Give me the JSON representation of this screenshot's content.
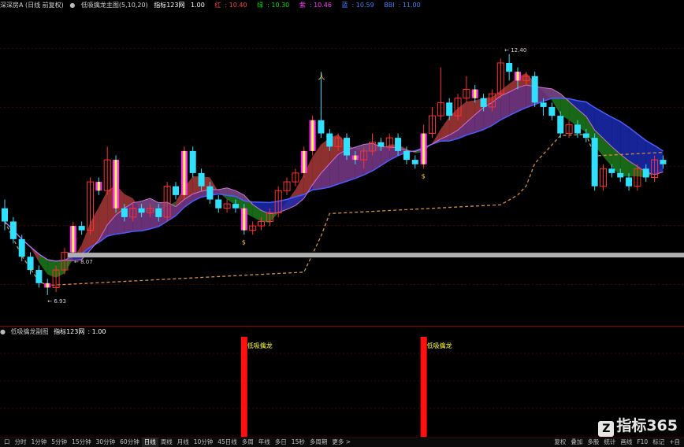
{
  "header": {
    "stock_title": "深深房A (日线 前复权)",
    "indicator_name": "低吸擒龙主图(5,10,20)",
    "label_indicator": "指标123网",
    "label_indicator_value": "1.00",
    "label_red": "红",
    "label_red_value": "10.40",
    "label_green": "绿",
    "label_green_value": "10.30",
    "label_purple": "紫",
    "label_purple_value": "10.46",
    "label_blue": "蓝",
    "label_blue_value": "10.59",
    "label_last": "BBI",
    "label_last_value": "11.00",
    "colors": {
      "title": "#d0d0d0",
      "red": "#ff4040",
      "green": "#00e000",
      "purple": "#ff40ff",
      "blue": "#4080ff",
      "yellow": "#ffff00"
    }
  },
  "main_chart": {
    "high_label": "12.40",
    "low_label": "6.93",
    "support_label": "8.07",
    "signal_icon_top": "人",
    "money_icon": "$"
  },
  "sub_chart": {
    "title": "低吸擒龙副图",
    "label_indicator": "指标123网",
    "label_indicator_value": "1.00",
    "signal_labels": [
      "低吸擒龙",
      "低吸擒龙"
    ]
  },
  "chart_data": {
    "type": "candlestick",
    "title": "深深房A (日线 前复权)",
    "ylim": [
      6.5,
      13.2
    ],
    "high_marker": 12.4,
    "low_marker": 6.93,
    "support_price": 8.07,
    "candles": [
      [
        8.9,
        8.6,
        9.1,
        8.4
      ],
      [
        8.6,
        8.2,
        8.7,
        8.1
      ],
      [
        8.2,
        7.8,
        8.3,
        7.7
      ],
      [
        7.8,
        7.5,
        7.9,
        7.4
      ],
      [
        7.5,
        7.2,
        7.6,
        7.1
      ],
      [
        7.2,
        7.1,
        7.3,
        6.93
      ],
      [
        7.1,
        7.5,
        7.6,
        7.0
      ],
      [
        7.5,
        7.9,
        8.0,
        7.4
      ],
      [
        7.9,
        8.5,
        8.6,
        7.8
      ],
      [
        8.5,
        8.4,
        8.6,
        8.3
      ],
      [
        8.4,
        9.5,
        9.6,
        8.3
      ],
      [
        9.5,
        9.3,
        9.6,
        9.2
      ],
      [
        9.3,
        10.0,
        10.3,
        9.2
      ],
      [
        10.0,
        8.9,
        10.1,
        8.8
      ],
      [
        8.9,
        8.7,
        9.0,
        8.6
      ],
      [
        8.7,
        8.9,
        9.0,
        8.6
      ],
      [
        8.9,
        8.8,
        9.0,
        8.7
      ],
      [
        8.8,
        8.9,
        9.0,
        8.7
      ],
      [
        8.9,
        8.7,
        9.0,
        8.6
      ],
      [
        8.7,
        9.4,
        9.5,
        8.6
      ],
      [
        9.4,
        9.2,
        9.5,
        9.1
      ],
      [
        9.2,
        10.2,
        10.3,
        9.1
      ],
      [
        10.2,
        9.7,
        10.3,
        9.6
      ],
      [
        9.7,
        9.4,
        9.8,
        9.3
      ],
      [
        9.4,
        9.1,
        9.5,
        9.0
      ],
      [
        9.1,
        8.9,
        9.2,
        8.8
      ],
      [
        8.9,
        9.0,
        9.1,
        8.8
      ],
      [
        9.0,
        8.9,
        9.1,
        8.8
      ],
      [
        8.9,
        8.4,
        9.0,
        8.3
      ],
      [
        8.4,
        8.5,
        8.6,
        8.3
      ],
      [
        8.5,
        8.6,
        8.7,
        8.4
      ],
      [
        8.6,
        8.8,
        8.9,
        8.5
      ],
      [
        8.8,
        9.3,
        9.4,
        8.7
      ],
      [
        9.3,
        9.5,
        9.6,
        9.2
      ],
      [
        9.5,
        9.7,
        9.8,
        9.4
      ],
      [
        9.7,
        10.2,
        10.3,
        9.6
      ],
      [
        10.2,
        10.9,
        11.0,
        10.1
      ],
      [
        10.9,
        10.6,
        12.0,
        10.5
      ],
      [
        10.6,
        10.3,
        10.7,
        10.2
      ],
      [
        10.3,
        10.5,
        10.6,
        10.2
      ],
      [
        10.5,
        10.1,
        10.6,
        10.0
      ],
      [
        10.1,
        10.0,
        10.2,
        9.9
      ],
      [
        10.0,
        10.2,
        10.3,
        9.8
      ],
      [
        10.2,
        10.4,
        10.6,
        10.1
      ],
      [
        10.4,
        10.3,
        10.5,
        10.2
      ],
      [
        10.3,
        10.5,
        10.6,
        10.2
      ],
      [
        10.5,
        10.2,
        10.6,
        10.1
      ],
      [
        10.2,
        10.0,
        10.3,
        9.9
      ],
      [
        10.0,
        9.9,
        10.1,
        9.8
      ],
      [
        9.9,
        10.6,
        10.8,
        9.8
      ],
      [
        10.6,
        11.0,
        11.2,
        10.5
      ],
      [
        11.0,
        11.3,
        12.1,
        10.9
      ],
      [
        11.3,
        11.0,
        11.4,
        10.9
      ],
      [
        11.0,
        11.4,
        11.5,
        10.9
      ],
      [
        11.4,
        11.6,
        11.9,
        11.3
      ],
      [
        11.6,
        11.4,
        11.7,
        11.3
      ],
      [
        11.4,
        11.2,
        11.5,
        11.1
      ],
      [
        11.2,
        11.5,
        11.6,
        11.1
      ],
      [
        11.5,
        12.2,
        12.3,
        11.4
      ],
      [
        12.2,
        12.0,
        12.4,
        11.8
      ],
      [
        12.0,
        11.8,
        12.1,
        11.6
      ],
      [
        11.8,
        11.9,
        12.0,
        11.7
      ],
      [
        11.9,
        11.3,
        12.0,
        11.2
      ],
      [
        11.3,
        11.2,
        11.4,
        11.0
      ],
      [
        11.2,
        11.0,
        11.3,
        10.9
      ],
      [
        11.0,
        10.6,
        11.1,
        10.5
      ],
      [
        10.6,
        10.8,
        10.9,
        10.5
      ],
      [
        10.8,
        10.6,
        10.9,
        10.5
      ],
      [
        10.6,
        10.5,
        10.7,
        10.4
      ],
      [
        10.5,
        9.4,
        10.6,
        9.3
      ],
      [
        9.4,
        9.8,
        9.9,
        9.3
      ],
      [
        9.8,
        9.7,
        9.9,
        9.6
      ],
      [
        9.7,
        9.6,
        9.8,
        9.5
      ],
      [
        9.6,
        9.4,
        9.7,
        9.3
      ],
      [
        9.4,
        9.8,
        9.9,
        9.3
      ],
      [
        9.8,
        9.6,
        9.9,
        9.5
      ],
      [
        9.6,
        10.0,
        10.1,
        9.5
      ],
      [
        10.0,
        9.9,
        10.1,
        9.8
      ]
    ],
    "special_bars": [
      5,
      8,
      11,
      13,
      21,
      28,
      35,
      36,
      41,
      49,
      55,
      60
    ],
    "sub_signals": [
      28,
      49
    ]
  },
  "bottom_bar": {
    "period_tabs": [
      "口",
      "分时",
      "1分钟",
      "5分钟",
      "15分钟",
      "30分钟",
      "60分钟",
      "日线",
      "周线",
      "月线",
      "10分钟",
      "45日线",
      "多周",
      "年线",
      "多日",
      "15秒",
      "多周期",
      "更多 >"
    ],
    "active_tab": "日线",
    "tool_tabs": [
      "复权",
      "叠加",
      "多股",
      "统计",
      "画线",
      "F10",
      "标记",
      "+自"
    ]
  },
  "watermark": {
    "logo_glyph": "Z",
    "text": "指标365"
  }
}
